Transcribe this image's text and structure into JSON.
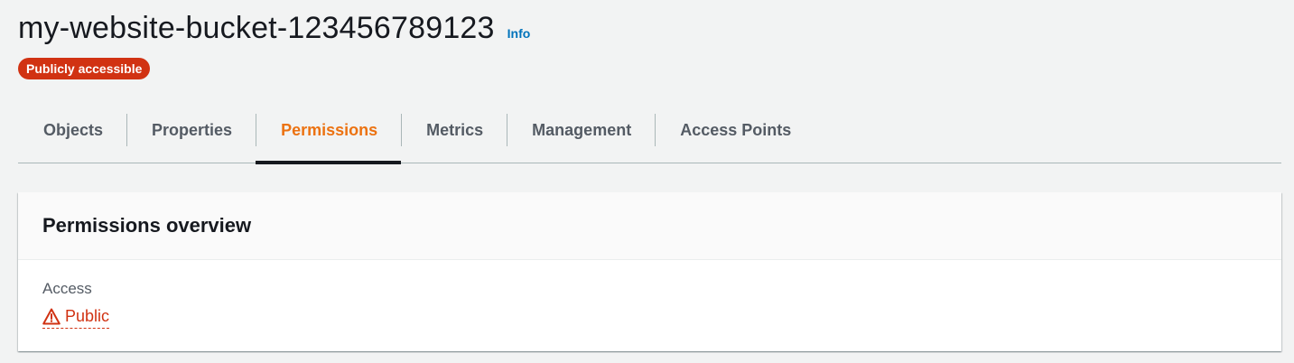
{
  "header": {
    "title": "my-website-bucket-123456789123",
    "info_label": "Info",
    "badge": "Publicly accessible"
  },
  "tabs": [
    {
      "label": "Objects",
      "active": false
    },
    {
      "label": "Properties",
      "active": false
    },
    {
      "label": "Permissions",
      "active": true
    },
    {
      "label": "Metrics",
      "active": false
    },
    {
      "label": "Management",
      "active": false
    },
    {
      "label": "Access Points",
      "active": false
    }
  ],
  "panel": {
    "title": "Permissions overview",
    "access_label": "Access",
    "access_value": "Public",
    "access_icon": "warning-icon"
  },
  "colors": {
    "accent": "#ec7211",
    "danger": "#d13212",
    "link": "#0073bb",
    "background": "#f2f3f3"
  }
}
